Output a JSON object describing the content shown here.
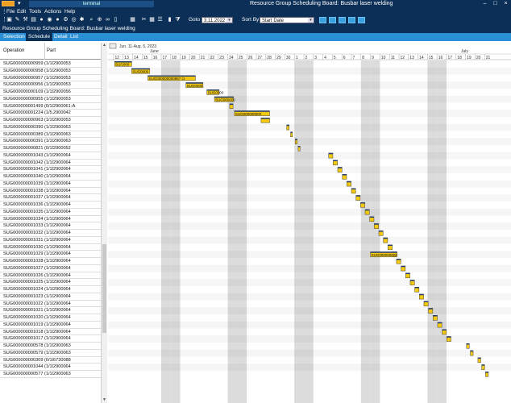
{
  "window": {
    "tab_title": "terminal",
    "title": "Resource Group Scheduling Board: Busbar laser welding"
  },
  "menu": [
    "File",
    "Edit",
    "Tools",
    "Actions",
    "Help"
  ],
  "toolbar": {
    "goto_label": "Goto",
    "goto_value": "3.11.2022",
    "sortby_label": "Sort By",
    "sortby_value": "Start Date"
  },
  "subtitle": "Resource Group Scheduling Board: Busbar laser welding",
  "tabs": [
    {
      "label": "Selection",
      "active": false
    },
    {
      "label": "Schedule",
      "active": true
    },
    {
      "label": "Detail",
      "active": false
    },
    {
      "label": "List",
      "active": false
    }
  ],
  "grid": {
    "col_operation": "Operation",
    "col_part": "Part",
    "rows": [
      {
        "op": "SUG000000000959 (1/10.2",
        "part": "2900053"
      },
      {
        "op": "SUG000000000958 (1/10.2",
        "part": "2900053"
      },
      {
        "op": "SUG000000000957 (1/10.2",
        "part": "2900053"
      },
      {
        "op": "SUG000000000956 (1/10.2",
        "part": "2900053"
      },
      {
        "op": "SUG000000000109 (1/10.2",
        "part": "2900056"
      },
      {
        "op": "SUG000000000955 (1/10.2",
        "part": "2900053"
      },
      {
        "op": "SUG000000001499 (0/10.1",
        "part": "2900061-A"
      },
      {
        "op": "SUG000000001224 (1/5.20",
        "part": "2900042"
      },
      {
        "op": "SUG000000000963 (1/10.2",
        "part": "2900053"
      },
      {
        "op": "SUG000000000390 (1/10.2",
        "part": "2900063"
      },
      {
        "op": "SUG000000000389 (1/10.2",
        "part": "2900063"
      },
      {
        "op": "SUG000000000391 (1/10.2",
        "part": "2900063"
      },
      {
        "op": "SUG000000000821 (0/15.2",
        "part": "2900052"
      },
      {
        "op": "SUG000000001043 (1/10.2",
        "part": "2900064"
      },
      {
        "op": "SUG000000001042 (1/10.2",
        "part": "2900064"
      },
      {
        "op": "SUG000000001041 (1/10.2",
        "part": "2900064"
      },
      {
        "op": "SUG000000001040 (1/10.2",
        "part": "2900064"
      },
      {
        "op": "SUG000000001039 (1/10.2",
        "part": "2900064"
      },
      {
        "op": "SUG000000001038 (1/10.2",
        "part": "2900064"
      },
      {
        "op": "SUG000000001037 (1/10.2",
        "part": "2900064"
      },
      {
        "op": "SUG000000001036 (1/10.2",
        "part": "2900064"
      },
      {
        "op": "SUG000000001035 (1/10.2",
        "part": "2900064"
      },
      {
        "op": "SUG000000001034 (1/10.2",
        "part": "2900064"
      },
      {
        "op": "SUG000000001033 (1/10.2",
        "part": "2900064"
      },
      {
        "op": "SUG000000001032 (1/10.2",
        "part": "2900064"
      },
      {
        "op": "SUG000000001031 (1/10.2",
        "part": "2900064"
      },
      {
        "op": "SUG000000001030 (1/10.2",
        "part": "2900064"
      },
      {
        "op": "SUG000000001029 (1/10.2",
        "part": "2900064"
      },
      {
        "op": "SUG000000001028 (1/10.2",
        "part": "2900064"
      },
      {
        "op": "SUG000000001027 (1/10.2",
        "part": "2900064"
      },
      {
        "op": "SUG000000001026 (1/10.2",
        "part": "2900064"
      },
      {
        "op": "SUG000000001025 (1/10.2",
        "part": "2900064"
      },
      {
        "op": "SUG000000001024 (1/10.2",
        "part": "2900064"
      },
      {
        "op": "SUG000000001023 (1/10.2",
        "part": "2900064"
      },
      {
        "op": "SUG000000001022 (1/10.2",
        "part": "2900064"
      },
      {
        "op": "SUG000000001021 (1/10.2",
        "part": "2900064"
      },
      {
        "op": "SUG000000001020 (1/10.2",
        "part": "2900064"
      },
      {
        "op": "SUG000000001019 (1/10.2",
        "part": "2900064"
      },
      {
        "op": "SUG000000001018 (1/10.2",
        "part": "2900064"
      },
      {
        "op": "SUG000000001017 (1/10.2",
        "part": "2900064"
      },
      {
        "op": "SUG000000000578 (1/10.2",
        "part": "2900063"
      },
      {
        "op": "SUG000000000579 (1/10.2",
        "part": "2900063"
      },
      {
        "op": "SUG000000000309 (0/10.2",
        "part": "6730088"
      },
      {
        "op": "SUG000000001044 (1/10.2",
        "part": "2900064"
      },
      {
        "op": "SUG000000000577 (1/10.2",
        "part": "2900063"
      }
    ]
  },
  "gantt": {
    "range_text": "Jun. 11-Aug. 6, 2023",
    "month_june": "June",
    "month_july": "July",
    "days": [
      "12",
      "13",
      "14",
      "15",
      "16",
      "17",
      "18",
      "19",
      "20",
      "21",
      "22",
      "23",
      "24",
      "25",
      "26",
      "27",
      "28",
      "29",
      "30",
      "1",
      "2",
      "3",
      "4",
      "5",
      "6",
      "7",
      "8",
      "9",
      "10",
      "11",
      "12",
      "13",
      "14",
      "15",
      "16",
      "17",
      "18",
      "19",
      "20",
      "21"
    ],
    "bar_labels": [
      "SUG000",
      "SUG0000",
      "SUG000000000957 (1",
      "SUG0000",
      "SUG0000",
      "SUG000000",
      "SUG000000000"
    ],
    "bar_color": "#f2c811",
    "bar_top_color": "#1f3c78"
  }
}
